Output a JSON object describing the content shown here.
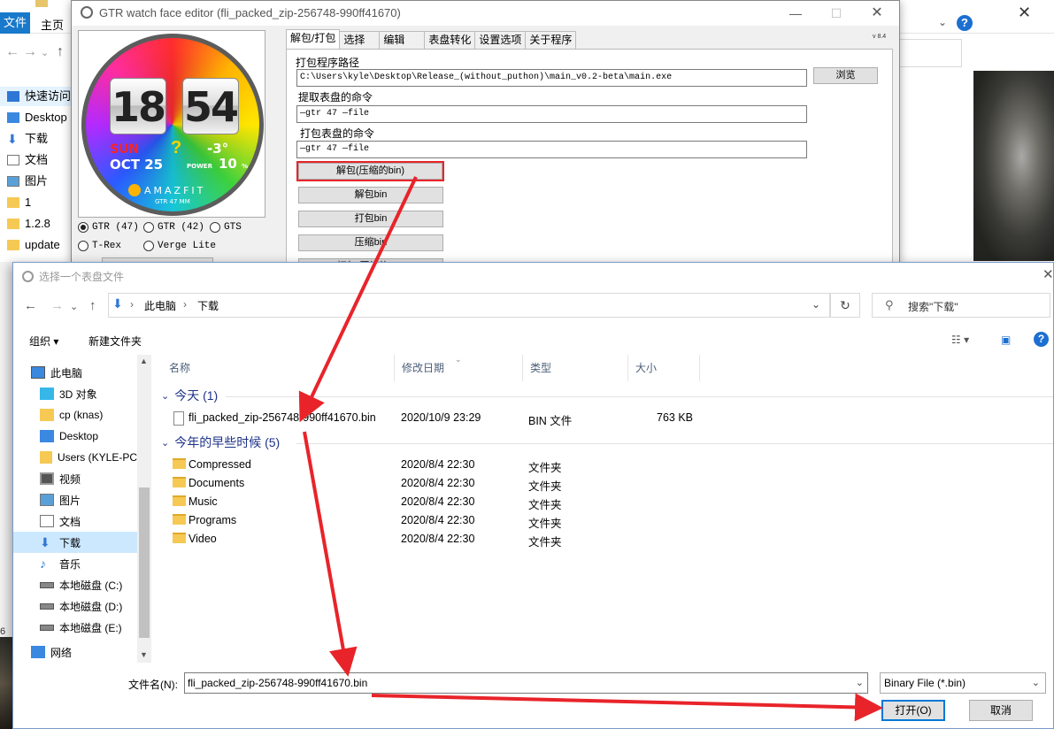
{
  "explorer": {
    "file_tab": "文件",
    "home_tab": "主页",
    "sidebar": [
      {
        "label": "快速访问"
      },
      {
        "label": "Desktop"
      },
      {
        "label": "下载"
      },
      {
        "label": "文档"
      },
      {
        "label": "图片"
      },
      {
        "label": "1"
      },
      {
        "label": "1.2.8"
      },
      {
        "label": "update"
      }
    ],
    "help": "?",
    "edge_text": "6"
  },
  "gtr": {
    "title": "GTR watch face editor (fli_packed_zip-256748-990ff41670)",
    "version": "v 8.4",
    "watch": {
      "hour": "18",
      "minute": "54",
      "day": "SUN",
      "date": "OCT 25",
      "weather": "?",
      "temp": "-3°",
      "power_label": "POWER",
      "power_value": "10",
      "power_unit": "%",
      "brand": "AMAZFIT",
      "model": "GTR 47 MM"
    },
    "models": [
      {
        "label": "GTR (47)",
        "selected": true
      },
      {
        "label": "GTR (42)",
        "selected": false
      },
      {
        "label": "GTS",
        "selected": false
      },
      {
        "label": "T-Rex",
        "selected": false
      },
      {
        "label": "Verge Lite",
        "selected": false
      }
    ],
    "tabs": [
      "解包/打包",
      "选择",
      "编辑",
      "表盘转化",
      "设置选项",
      "关于程序"
    ],
    "path_label": "打包程序路径",
    "path_value": "C:\\Users\\kyle\\Desktop\\Release_(without_puthon)\\main_v0.2-beta\\main.exe",
    "browse": "浏览",
    "extract_label": "提取表盘的命令",
    "extract_cmd": "—gtr 47 —file",
    "pack_label": "打包表盘的命令",
    "pack_cmd": "—gtr 47 —file",
    "buttons": [
      "解包(压缩的bin)",
      "解包bin",
      "打包bin",
      "压缩bin",
      "打包(压缩的bin)"
    ]
  },
  "dialog": {
    "title": "选择一个表盘文件",
    "breadcrumb": [
      "此电脑",
      "下载"
    ],
    "search_placeholder": "搜索\"下载\"",
    "organize": "组织 ▾",
    "new_folder": "新建文件夹",
    "nav": [
      {
        "label": "此电脑",
        "icon": "computer-icon"
      },
      {
        "label": "3D 对象",
        "icon": "3d-objects-icon"
      },
      {
        "label": "cp (knas)",
        "icon": "user-folder-icon"
      },
      {
        "label": "Desktop",
        "icon": "desktop-icon"
      },
      {
        "label": "Users (KYLE-PC",
        "icon": "user-folder-icon"
      },
      {
        "label": "视频",
        "icon": "video-icon"
      },
      {
        "label": "图片",
        "icon": "pictures-icon"
      },
      {
        "label": "文档",
        "icon": "documents-icon"
      },
      {
        "label": "下载",
        "icon": "download-icon"
      },
      {
        "label": "音乐",
        "icon": "music-icon"
      },
      {
        "label": "本地磁盘 (C:)",
        "icon": "drive-icon"
      },
      {
        "label": "本地磁盘 (D:)",
        "icon": "drive-icon"
      },
      {
        "label": "本地磁盘 (E:)",
        "icon": "drive-icon"
      },
      {
        "label": "网络",
        "icon": "network-icon"
      }
    ],
    "columns": [
      "名称",
      "修改日期",
      "类型",
      "大小"
    ],
    "groups": [
      {
        "title": "今天 (1)",
        "files": [
          {
            "name": "fli_packed_zip-256748-990ff41670.bin",
            "date": "2020/10/9 23:29",
            "type": "BIN 文件",
            "size": "763 KB",
            "kind": "file"
          }
        ]
      },
      {
        "title": "今年的早些时候 (5)",
        "files": [
          {
            "name": "Compressed",
            "date": "2020/8/4 22:30",
            "type": "文件夹",
            "size": "",
            "kind": "folder"
          },
          {
            "name": "Documents",
            "date": "2020/8/4 22:30",
            "type": "文件夹",
            "size": "",
            "kind": "folder"
          },
          {
            "name": "Music",
            "date": "2020/8/4 22:30",
            "type": "文件夹",
            "size": "",
            "kind": "folder"
          },
          {
            "name": "Programs",
            "date": "2020/8/4 22:30",
            "type": "文件夹",
            "size": "",
            "kind": "folder"
          },
          {
            "name": "Video",
            "date": "2020/8/4 22:30",
            "type": "文件夹",
            "size": "",
            "kind": "folder"
          }
        ]
      }
    ],
    "filename_label": "文件名(N):",
    "filename_value": "fli_packed_zip-256748-990ff41670.bin",
    "filetype": "Binary File (*.bin)",
    "open_button": "打开(O)",
    "cancel_button": "取消"
  },
  "colors": {
    "accent": "#0078d7",
    "highlight_red": "#e8242a",
    "group_blue": "#1e3287",
    "selection": "#cce8ff"
  }
}
